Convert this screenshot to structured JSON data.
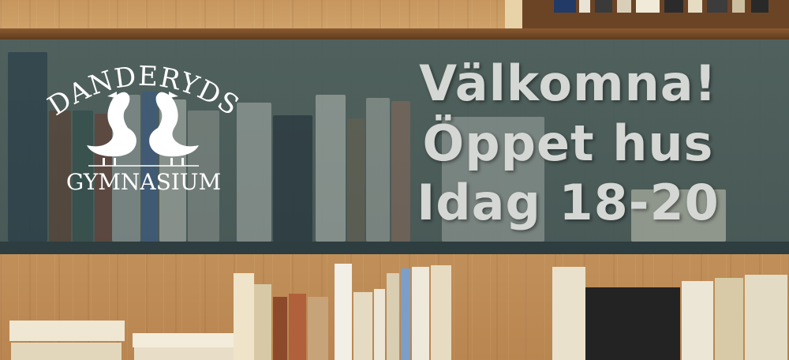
{
  "logo": {
    "line1": "DANDERYDS",
    "line2": "GYMNASIUM",
    "icon": "two-geese-icon"
  },
  "headline": {
    "line1": "Välkomna!",
    "line2": "Öppet hus",
    "line3": "Idag 18-20"
  },
  "colors": {
    "overlay": "#465c5c",
    "headline_text": "#d4d7d4",
    "wood": "#c6965e"
  }
}
